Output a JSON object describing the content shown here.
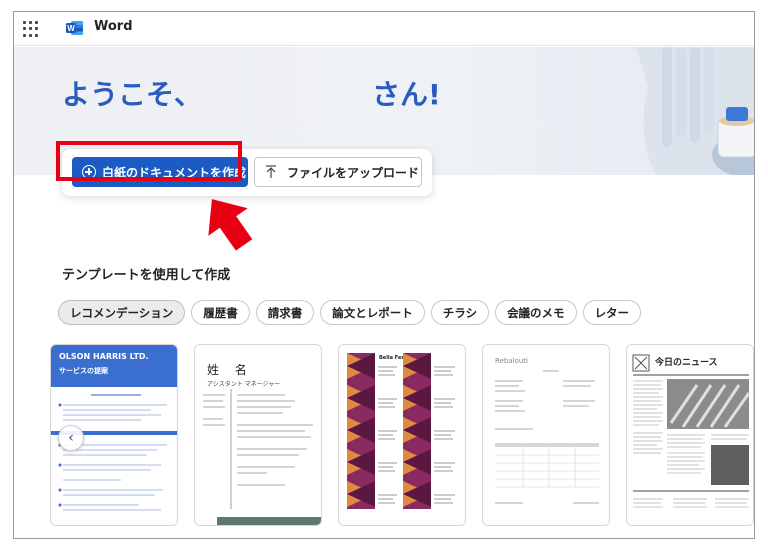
{
  "header": {
    "app_name": "Word"
  },
  "hero": {
    "greeting": "ようこそ、",
    "greeting_suffix": "さん!"
  },
  "actions": {
    "new_document_label": "白紙のドキュメントを作成",
    "upload_label": "ファイルをアップロード"
  },
  "templates_section": {
    "title": "テンプレートを使用して作成",
    "filters": [
      {
        "label": "レコメンデーション",
        "selected": true
      },
      {
        "label": "履歴書",
        "selected": false
      },
      {
        "label": "請求書",
        "selected": false
      },
      {
        "label": "論文とレポート",
        "selected": false
      },
      {
        "label": "チラシ",
        "selected": false
      },
      {
        "label": "会議のメモ",
        "selected": false
      },
      {
        "label": "レター",
        "selected": false
      }
    ],
    "cards": [
      {
        "title": "OLSON HARRIS LTD.",
        "subtitle": "サービスの提案"
      },
      {
        "name": "姓 名",
        "role": "アシスタント マネージャー"
      },
      {
        "heading": "Bella Fernand"
      },
      {
        "heading": "Rebalouti"
      },
      {
        "heading": "今日のニュース"
      }
    ]
  },
  "colors": {
    "accent_blue": "#1b5bc4",
    "greeting_blue": "#2a5bbf",
    "annotation_red": "#e60012",
    "word_blue": "#185abd"
  }
}
